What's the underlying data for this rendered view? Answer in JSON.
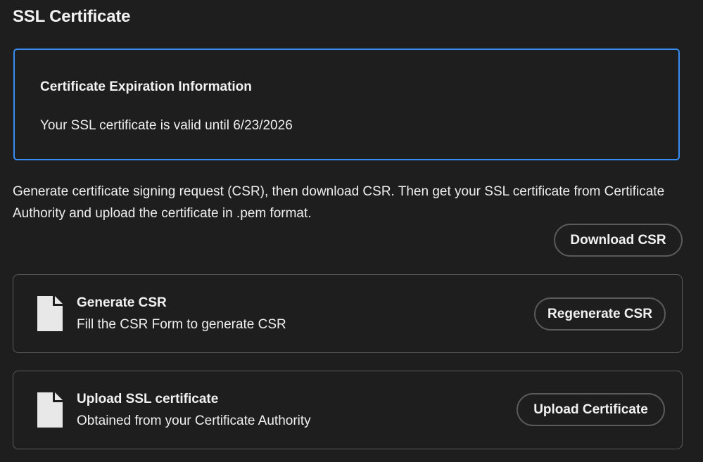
{
  "page": {
    "title": "SSL Certificate"
  },
  "expiration": {
    "heading": "Certificate Expiration Information",
    "text": "Your SSL certificate is valid until 6/23/2026"
  },
  "description": "Generate certificate signing request (CSR), then download CSR. Then get your SSL certificate from Certificate Authority and upload the certificate in .pem format.",
  "download_button": {
    "label": "Download CSR"
  },
  "cards": [
    {
      "icon": "file-icon",
      "title": "Generate CSR",
      "subtitle": "Fill the CSR Form to generate CSR",
      "button_label": "Regenerate CSR"
    },
    {
      "icon": "file-icon",
      "title": "Upload SSL certificate",
      "subtitle": "Obtained from your Certificate Authority",
      "button_label": "Upload Certificate"
    }
  ],
  "colors": {
    "background": "#1e1e1e",
    "accent_border": "#378ef0",
    "button_border": "#5a5a5a",
    "text": "#f0f0f0"
  }
}
